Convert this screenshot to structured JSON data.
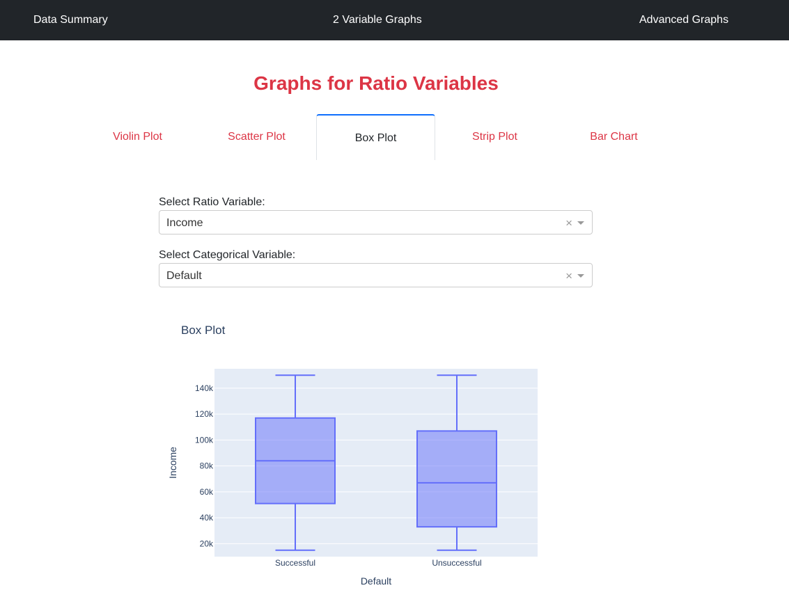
{
  "navbar": {
    "links": [
      "Data Summary",
      "2 Variable Graphs",
      "Advanced Graphs"
    ]
  },
  "page_title": "Graphs for Ratio Variables",
  "tabs": [
    {
      "label": "Violin Plot",
      "active": false
    },
    {
      "label": "Scatter Plot",
      "active": false
    },
    {
      "label": "Box Plot",
      "active": true
    },
    {
      "label": "Strip Plot",
      "active": false
    },
    {
      "label": "Bar Chart",
      "active": false
    }
  ],
  "ratio_select": {
    "label": "Select Ratio Variable:",
    "value": "Income",
    "clear_icon": "×"
  },
  "categorical_select": {
    "label": "Select Categorical Variable:",
    "value": "Default",
    "clear_icon": "×"
  },
  "colors": {
    "nav_bg": "#212529",
    "accent": "#dc3545",
    "plot_bg": "#e5ecf6",
    "box_line": "#636efa",
    "box_fill": "rgba(99,110,250,0.5)"
  },
  "chart_data": {
    "type": "box",
    "title": "Box Plot",
    "xlabel": "Default",
    "ylabel": "Income",
    "ylim": [
      10000,
      155000
    ],
    "yticks": [
      20000,
      40000,
      60000,
      80000,
      100000,
      120000,
      140000
    ],
    "ytick_labels": [
      "20k",
      "40k",
      "60k",
      "80k",
      "100k",
      "120k",
      "140k"
    ],
    "categories": [
      "Successful",
      "Unsuccessful"
    ],
    "boxes": [
      {
        "category": "Successful",
        "min": 15000,
        "q1": 51000,
        "median": 84000,
        "q3": 117000,
        "max": 150000
      },
      {
        "category": "Unsuccessful",
        "min": 15000,
        "q1": 33000,
        "median": 67000,
        "q3": 107000,
        "max": 150000
      }
    ],
    "grid": true
  }
}
